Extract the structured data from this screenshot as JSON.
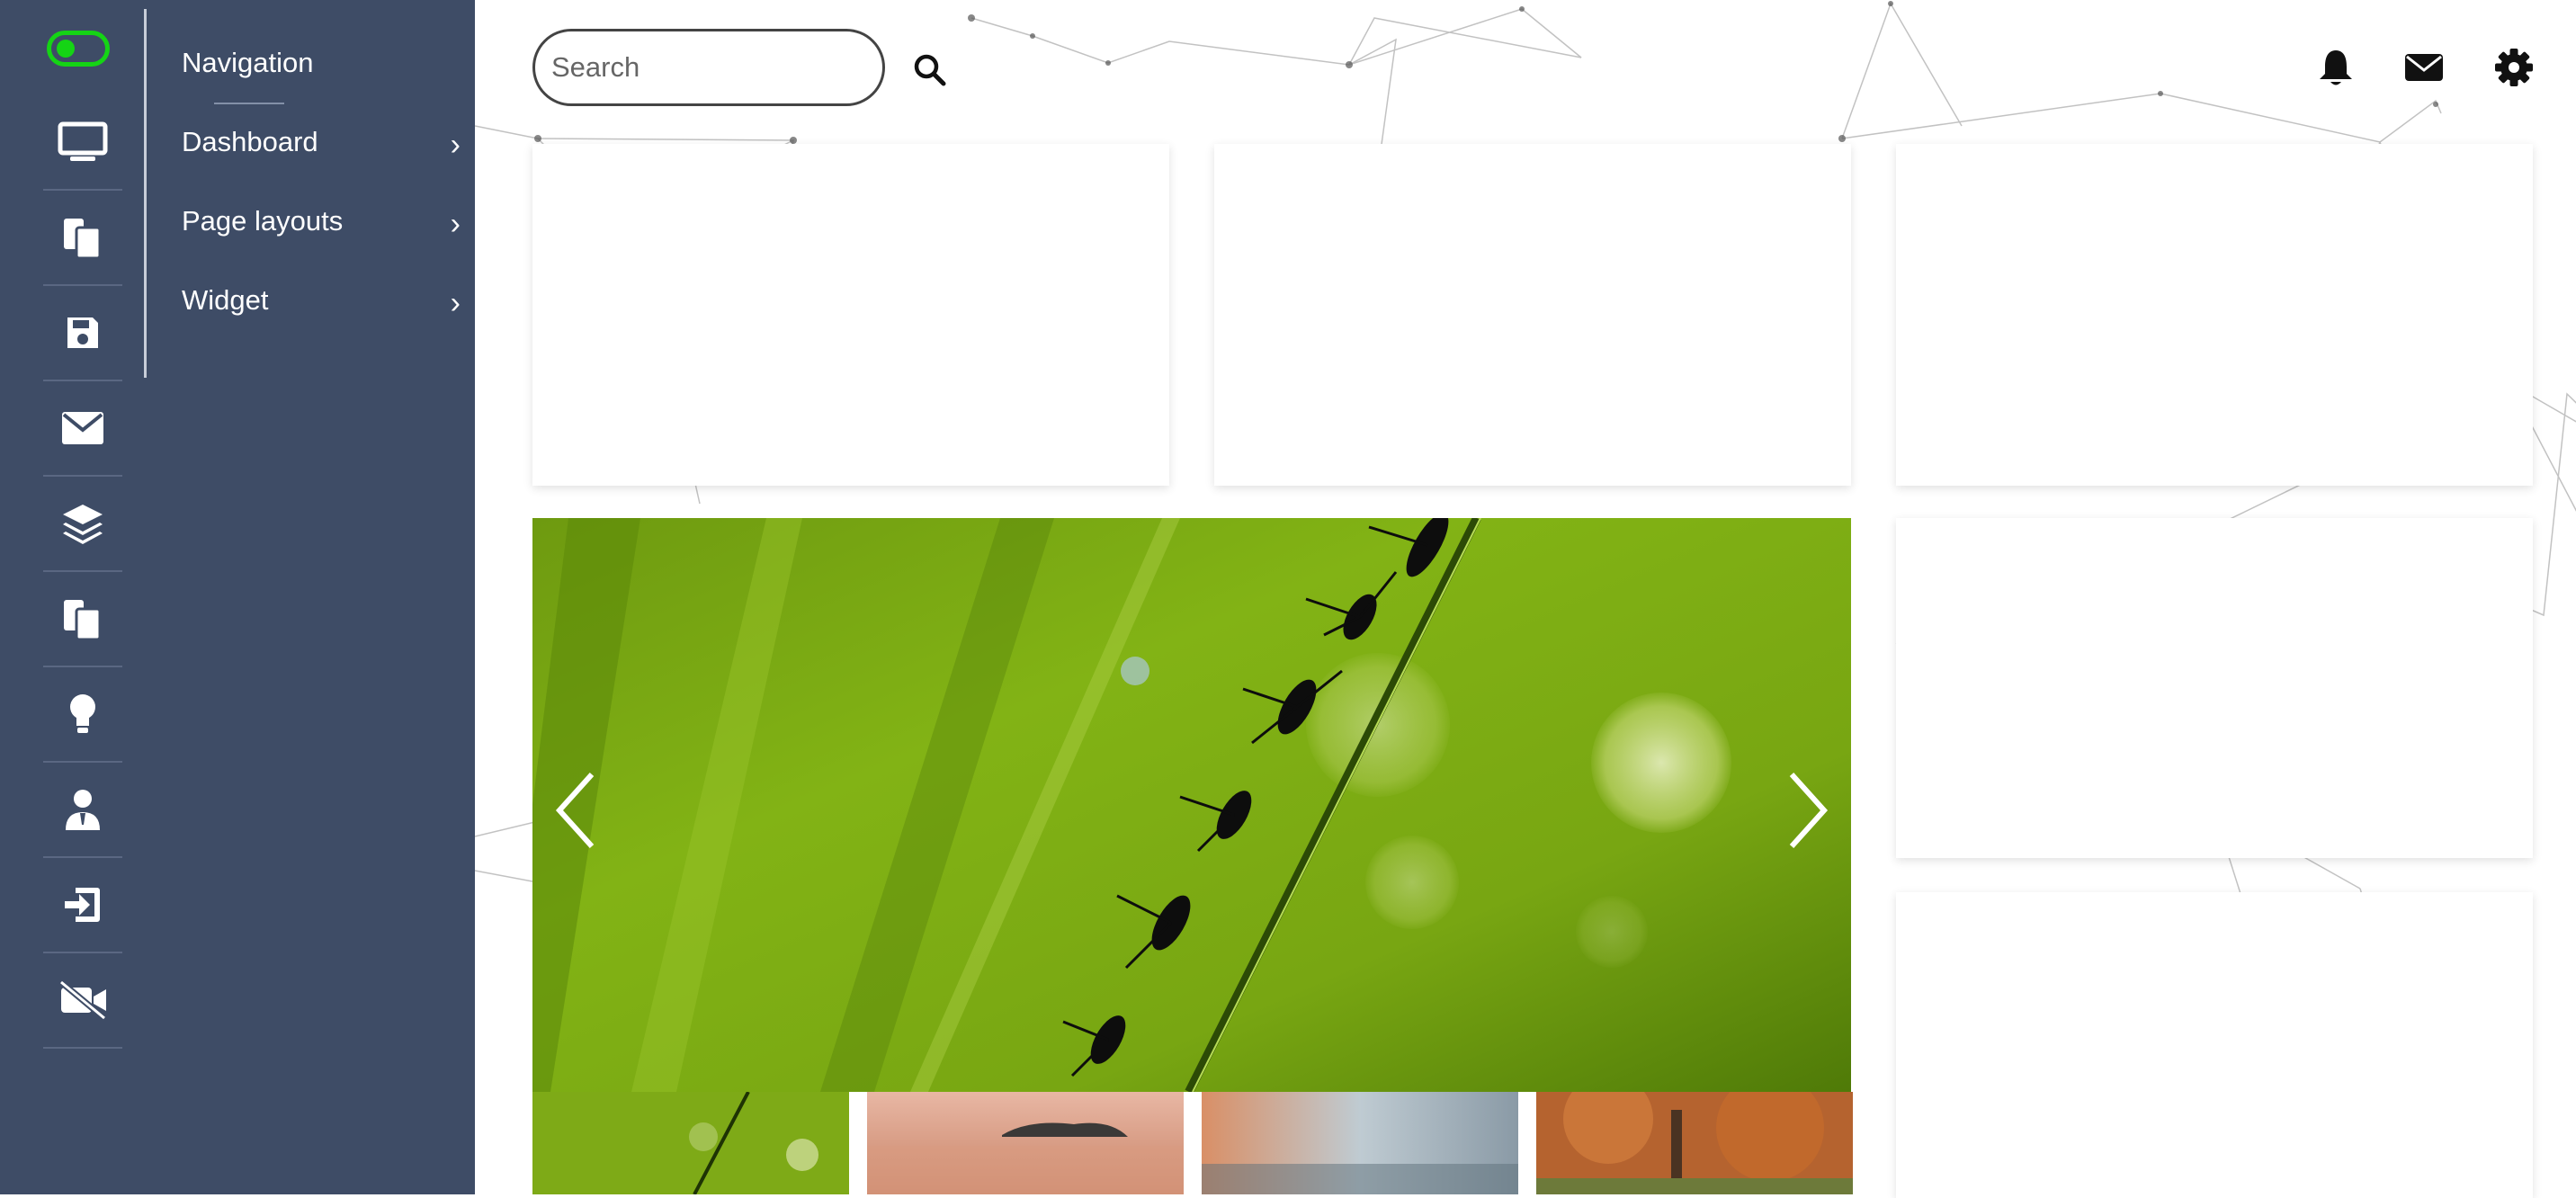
{
  "sidebar": {
    "toggle": {
      "state": "on",
      "color": "#15d415"
    },
    "rail_icons": [
      "monitor-icon",
      "copy-icon",
      "save-icon",
      "mail-icon",
      "layers-icon",
      "clipboard-icon",
      "lightbulb-icon",
      "user-tie-icon",
      "sign-in-icon",
      "video-slash-icon"
    ]
  },
  "nav": {
    "title": "Navigation",
    "items": [
      {
        "label": "Dashboard"
      },
      {
        "label": "Page layouts"
      },
      {
        "label": "Widget"
      }
    ],
    "chevron": "›"
  },
  "header": {
    "search_placeholder": "Search",
    "icons": [
      "search-icon",
      "bell-icon",
      "envelope-icon",
      "gear-icon"
    ]
  },
  "carousel": {
    "arrow_left": "‹",
    "arrow_right": "›",
    "thumbnails": [
      "ants-on-grass",
      "sunset-lake",
      "misty-autumn-shore",
      "autumn-park"
    ]
  },
  "colors": {
    "sidebar_bg": "#3e4c66",
    "accent": "#15d415"
  }
}
